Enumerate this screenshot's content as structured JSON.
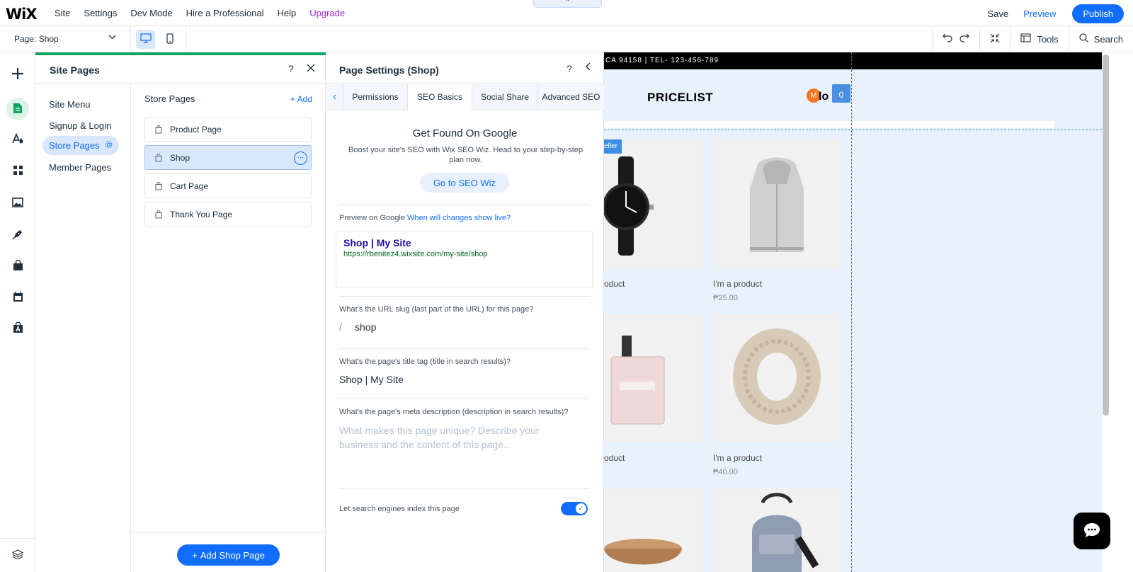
{
  "topbar": {
    "logo": "WiX",
    "nav": [
      "Site",
      "Settings",
      "Dev Mode",
      "Hire a Professional",
      "Help"
    ],
    "upgrade": "Upgrade",
    "center_tab": "⌃",
    "save": "Save",
    "preview": "Preview",
    "publish": "Publish"
  },
  "secondbar": {
    "page_selector": "Page: Shop",
    "tools": "Tools",
    "search": "Search"
  },
  "site_pages": {
    "title": "Site Pages",
    "help": "?",
    "menu": [
      "Site Menu",
      "Signup & Login",
      "Store Pages",
      "Member Pages"
    ],
    "active_menu": "Store Pages",
    "list_title": "Store Pages",
    "add_label": "+ Add",
    "pages": [
      "Product Page",
      "Shop",
      "Cart Page",
      "Thank You Page"
    ],
    "selected_page": "Shop",
    "add_button": "Add Shop Page"
  },
  "page_settings": {
    "title": "Page Settings (Shop)",
    "help": "?",
    "tabs": [
      "Permissions",
      "SEO Basics",
      "Social Share",
      "Advanced SEO"
    ],
    "active_tab": "SEO Basics",
    "seo_title": "Get Found On Google",
    "seo_desc": "Boost your site's SEO with Wix SEO Wiz. Head to your step-by-step plan now.",
    "seo_button": "Go to SEO Wiz",
    "preview_label": "Preview on Google",
    "preview_link": "When will changes show live?",
    "google_title": "Shop | My Site",
    "google_url": "https://rbenitez4.wixsite.com/my-site/shop",
    "slug_label": "What's the URL slug (last part of the URL) for this page?",
    "slug_prefix": "/",
    "slug_value": "shop",
    "title_tag_label": "What's the page's title tag (title in search results)?",
    "title_tag_value": "Shop | My Site",
    "meta_label": "What's the page's meta description (description in search results)?",
    "meta_placeholder": "What makes this page unique? Describe your business and the content of this page...",
    "index_label": "Let search engines index this page",
    "index_enabled": true
  },
  "canvas": {
    "top_strip": "CA 94158  |  TEL- 123-456-789",
    "pricelist": "PRICELIST",
    "avatar_letter": "M",
    "login_partial": "lo",
    "cart_count": "0",
    "badge": "eller",
    "products": [
      {
        "name": "oduct",
        "price": ""
      },
      {
        "name": "I'm a product",
        "price": "₱25.00"
      },
      {
        "name": "oduct",
        "price": ""
      },
      {
        "name": "I'm a product",
        "price": "₱40.00"
      }
    ]
  },
  "colors": {
    "accent": "#116dff",
    "upgrade": "#9a27d5",
    "panel_bar": "#0aa35f",
    "canvas_bg": "#e8f2fc"
  }
}
